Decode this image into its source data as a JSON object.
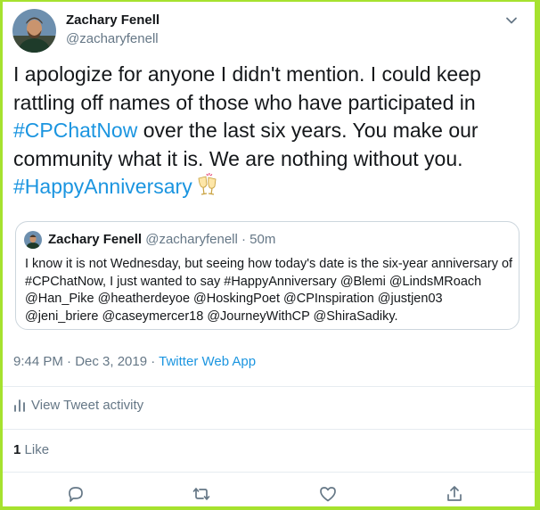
{
  "author": {
    "name": "Zachary Fenell",
    "handle": "@zacharyfenell"
  },
  "tweet": {
    "line1": "I apologize for anyone I didn't mention. I could keep rattling off names of those who have participated in ",
    "hashtag1": "#CPChatNow",
    "line2": " over the last six years. You make our community what it is. We are nothing without you. ",
    "hashtag2": "#HappyAnniversary"
  },
  "quoted": {
    "name": "Zachary Fenell",
    "handle": "@zacharyfenell",
    "sep": " · ",
    "time": "50m",
    "text": "I know it is not Wednesday, but seeing how today's date is the six-year anniversary of #CPChatNow, I just wanted to say #HappyAnniversary @Blemi @LindsMRoach @Han_Pike @heatherdeyoe @HoskingPoet @CPInspiration @justjen03 @jeni_briere @caseymercer18 @JourneyWithCP @ShiraSadiky."
  },
  "meta": {
    "timestamp": "9:44 PM · Dec 3, 2019 · ",
    "source": "Twitter Web App"
  },
  "activity_label": "View Tweet activity",
  "likes": {
    "count": "1",
    "label": "Like"
  },
  "icons": [
    "chevron-down-icon",
    "bar-chart-icon",
    "reply-icon",
    "retweet-icon",
    "heart-icon",
    "share-icon",
    "clinking-glasses-emoji"
  ],
  "colors": {
    "link": "#1b95e0",
    "text": "#14171a",
    "muted": "#657786",
    "border": "#ccd6dd",
    "frame": "#a6e22e"
  }
}
